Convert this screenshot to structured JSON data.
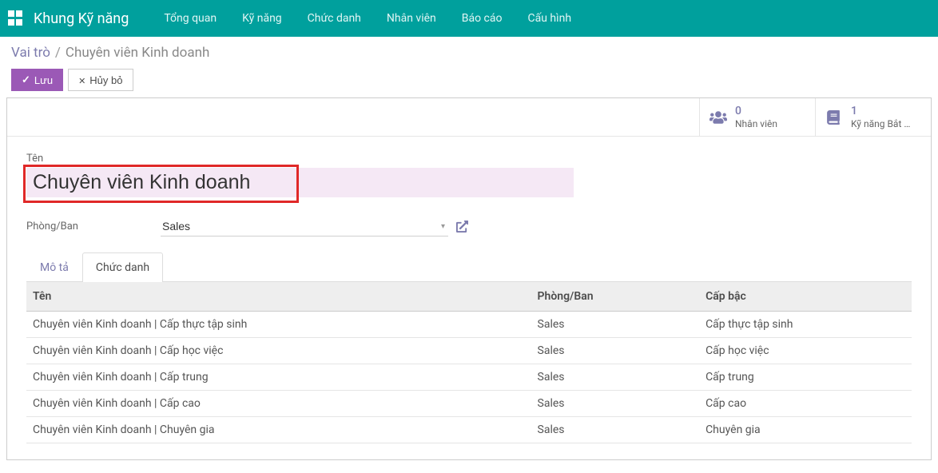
{
  "navbar": {
    "brand": "Khung Kỹ năng",
    "menu": [
      "Tổng quan",
      "Kỹ năng",
      "Chức danh",
      "Nhân viên",
      "Báo cáo",
      "Cấu hình"
    ]
  },
  "breadcrumb": {
    "root": "Vai trò",
    "current": "Chuyên viên Kinh doanh"
  },
  "buttons": {
    "save": "Lưu",
    "discard": "Hủy bỏ"
  },
  "stats": [
    {
      "icon": "users",
      "value": "0",
      "label": "Nhân viên"
    },
    {
      "icon": "book",
      "value": "1",
      "label": "Kỹ năng Bắt …"
    }
  ],
  "form": {
    "name_label": "Tên",
    "name_value": "Chuyên viên Kinh doanh",
    "dept_label": "Phòng/Ban",
    "dept_value": "Sales"
  },
  "tabs": [
    {
      "label": "Mô tả",
      "active": false
    },
    {
      "label": "Chức danh",
      "active": true
    }
  ],
  "table": {
    "headers": [
      "Tên",
      "Phòng/Ban",
      "Cấp bậc"
    ],
    "rows": [
      [
        "Chuyên viên Kinh doanh | Cấp thực tập sinh",
        "Sales",
        "Cấp thực tập sinh"
      ],
      [
        "Chuyên viên Kinh doanh | Cấp học việc",
        "Sales",
        "Cấp học việc"
      ],
      [
        "Chuyên viên Kinh doanh | Cấp trung",
        "Sales",
        "Cấp trung"
      ],
      [
        "Chuyên viên Kinh doanh | Cấp cao",
        "Sales",
        "Cấp cao"
      ],
      [
        "Chuyên viên Kinh doanh | Chuyên gia",
        "Sales",
        "Chuyên gia"
      ]
    ]
  }
}
